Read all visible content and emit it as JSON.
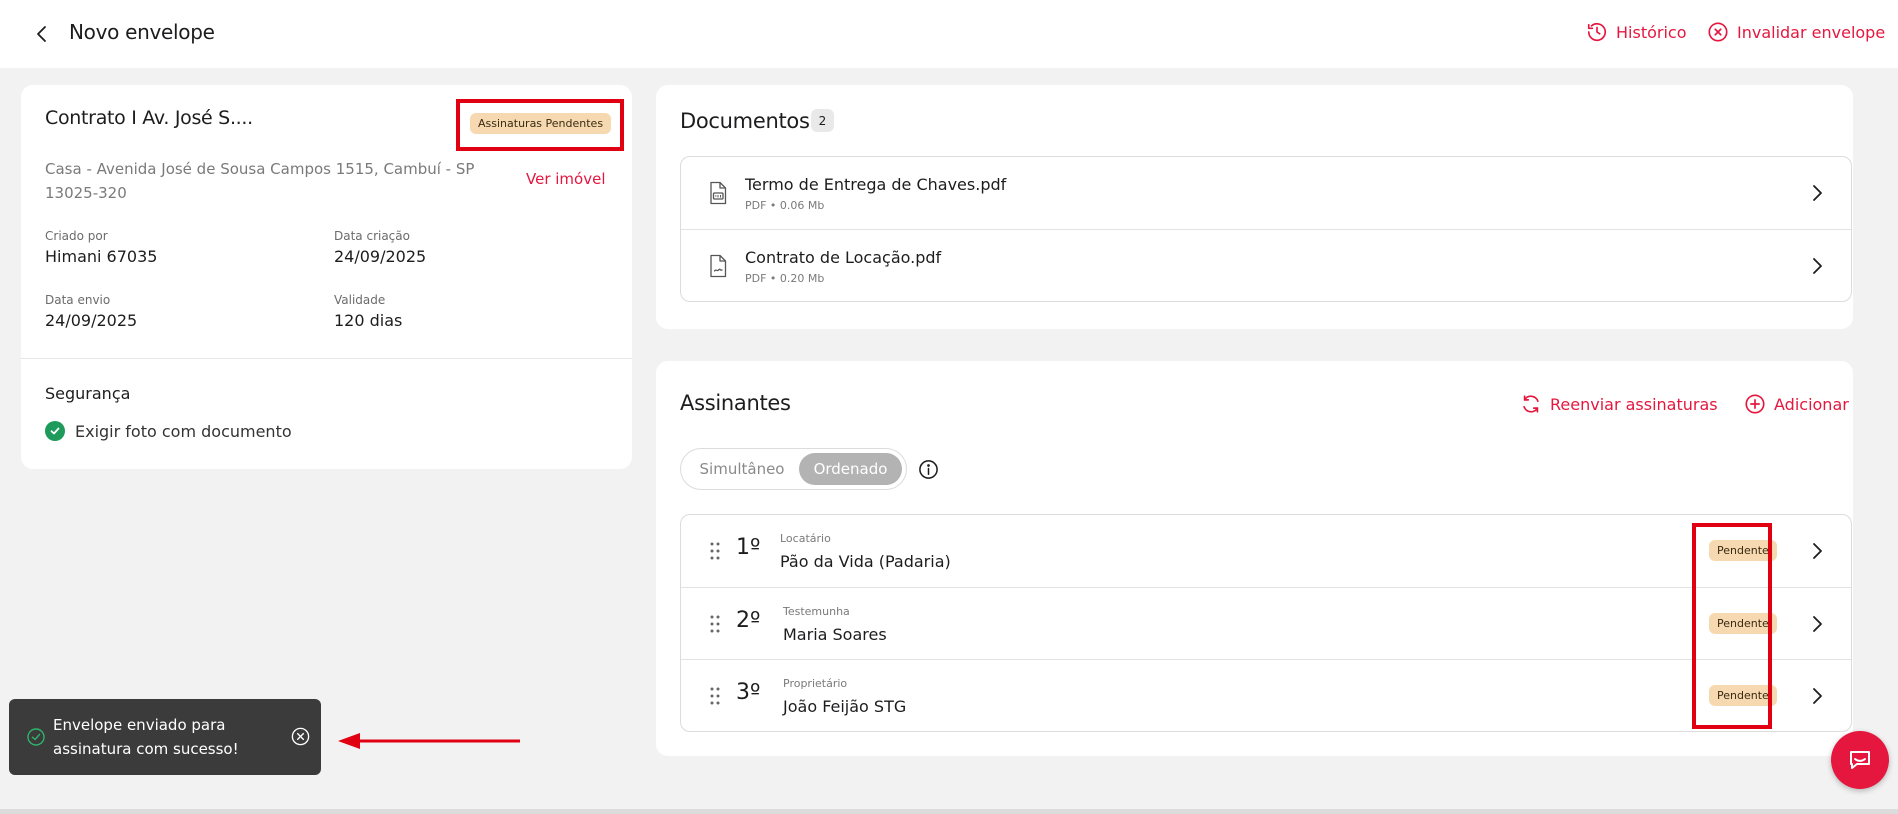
{
  "header": {
    "title": "Novo envelope",
    "back_icon": "chevron-left-icon",
    "historico_label": "Histórico",
    "invalidar_label": "Invalidar envelope"
  },
  "colors": {
    "accent": "#e5173f",
    "badge_bg": "#f6d9b0",
    "success": "#1e9a5a",
    "highlight": "#e00012"
  },
  "contract": {
    "title": "Contrato I Av. José S....",
    "status_badge": "Assinaturas Pendentes",
    "address": "Casa - Avenida José de Sousa Campos 1515, Cambuí - SP 13025-320",
    "view_property_label": "Ver imóvel",
    "meta": {
      "criado_por": {
        "label": "Criado por",
        "value": "Himani 67035"
      },
      "data_criacao": {
        "label": "Data criação",
        "value": "24/09/2025"
      },
      "data_envio": {
        "label": "Data envio",
        "value": "24/09/2025"
      },
      "validade": {
        "label": "Validade",
        "value": "120 dias"
      }
    },
    "security": {
      "title": "Segurança",
      "item": "Exigir foto com documento"
    }
  },
  "documents": {
    "title": "Documentos",
    "count": "2",
    "items": [
      {
        "name": "Termo de Entrega de Chaves.pdf",
        "meta": "PDF • 0.06 Mb",
        "icon": "pdf-file-icon"
      },
      {
        "name": "Contrato de Locação.pdf",
        "meta": "PDF • 0.20 Mb",
        "icon": "contract-file-icon"
      }
    ]
  },
  "signers": {
    "title": "Assinantes",
    "resend_label": "Reenviar assinaturas",
    "add_label": "Adicionar",
    "mode": {
      "option1": "Simultâneo",
      "option2": "Ordenado",
      "selected": "Ordenado"
    },
    "items": [
      {
        "order": "1º",
        "role": "Locatário",
        "name": "Pão da Vida (Padaria)",
        "status": "Pendente"
      },
      {
        "order": "2º",
        "role": "Testemunha",
        "name": "Maria Soares",
        "status": "Pendente"
      },
      {
        "order": "3º",
        "role": "Proprietário",
        "name": "João Feijão STG",
        "status": "Pendente"
      }
    ]
  },
  "toast": {
    "message": "Envelope enviado para assinatura com sucesso!"
  }
}
